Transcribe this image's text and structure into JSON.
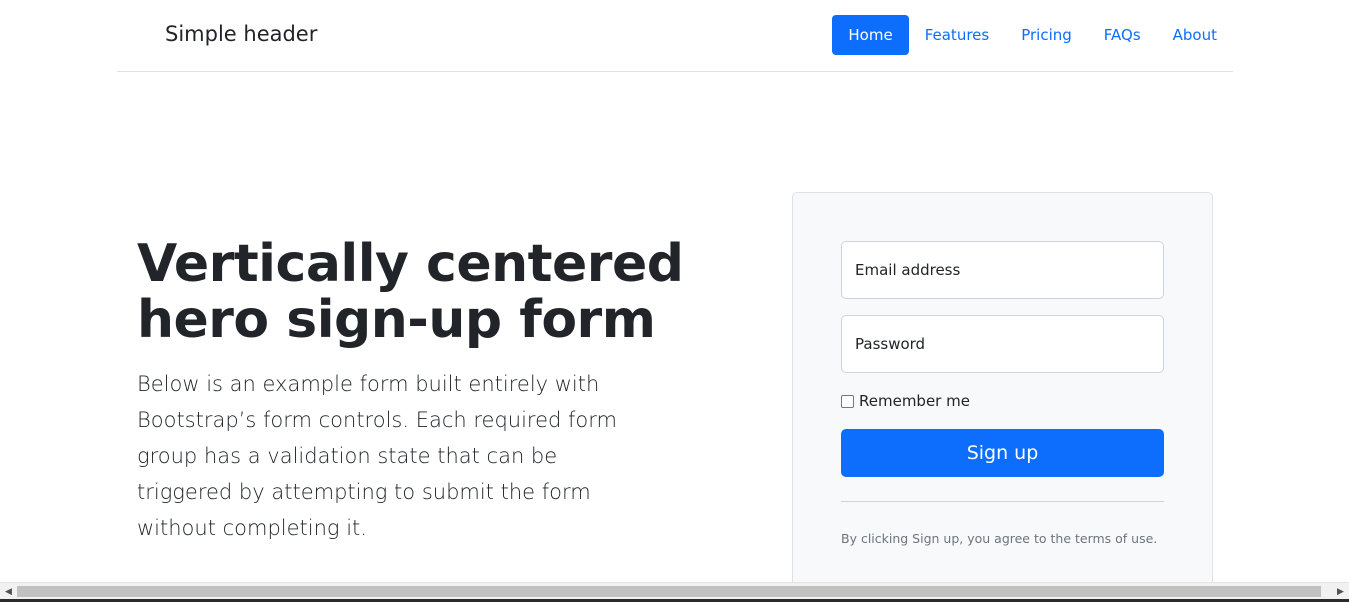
{
  "header": {
    "brand": "Simple header",
    "nav": [
      {
        "label": "Home",
        "active": true
      },
      {
        "label": "Features",
        "active": false
      },
      {
        "label": "Pricing",
        "active": false
      },
      {
        "label": "FAQs",
        "active": false
      },
      {
        "label": "About",
        "active": false
      }
    ]
  },
  "hero": {
    "title": "Vertically centered hero sign-up form",
    "lead": "Below is an example form built entirely with Bootstrap’s form controls. Each required form group has a validation state that can be triggered by attempting to submit the form without completing it."
  },
  "form": {
    "email_placeholder": "Email address",
    "password_placeholder": "Password",
    "remember_label": "Remember me",
    "remember_checked": false,
    "submit_label": "Sign up",
    "terms": "By clicking Sign up, you agree to the terms of use."
  },
  "scrollbar": {
    "left_arrow_icon": "arrow-left-icon",
    "right_arrow_icon": "arrow-right-icon"
  },
  "colors": {
    "primary": "#0d6efd",
    "text": "#212529",
    "muted": "#6c757d",
    "card_bg": "#f8f9fa"
  }
}
